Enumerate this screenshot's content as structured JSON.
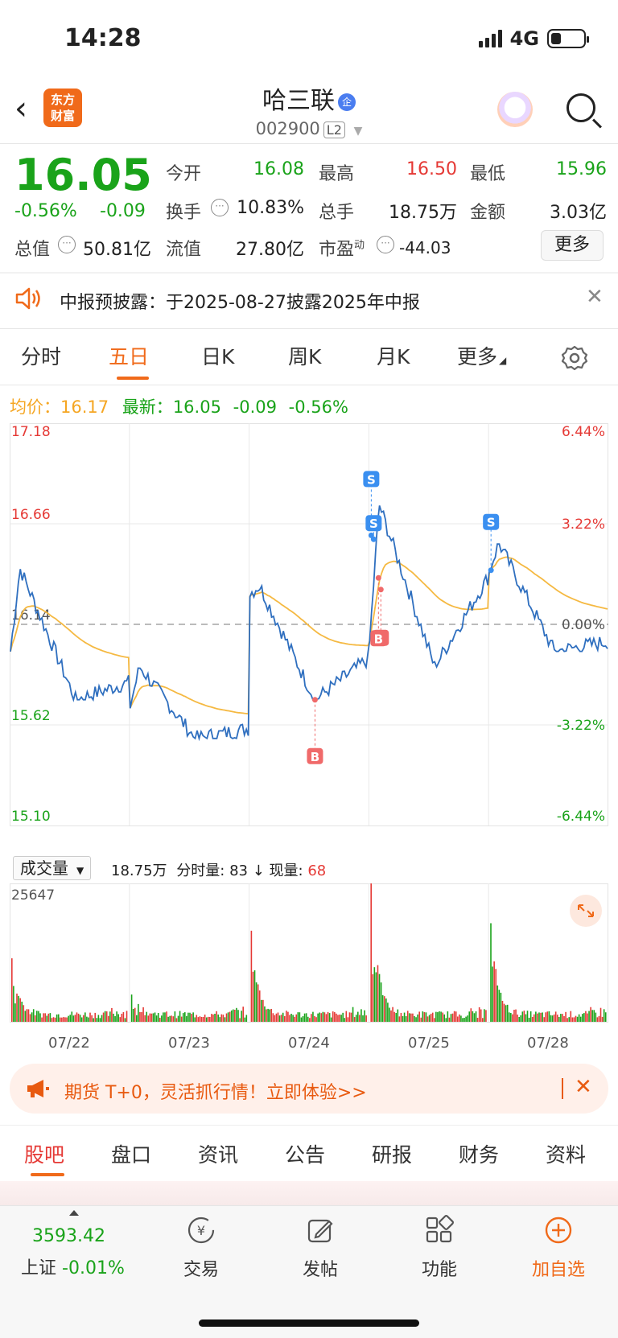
{
  "status_bar": {
    "time": "14:28",
    "network": "4G"
  },
  "header": {
    "logo_text": "东方财富",
    "stock_name": "哈三联",
    "name_badge": "企",
    "stock_code": "002900",
    "level_badge": "L2"
  },
  "quote": {
    "price": "16.05",
    "change_pct": "-0.56%",
    "change": "-0.09",
    "fields": [
      {
        "label": "今开",
        "value": "16.08",
        "color": "green"
      },
      {
        "label": "最高",
        "value": "16.50",
        "color": "red"
      },
      {
        "label": "最低",
        "value": "15.96",
        "color": "green"
      },
      {
        "label": "换手",
        "value": "10.83%",
        "color": "black"
      },
      {
        "label": "总手",
        "value": "18.75万",
        "color": "black"
      },
      {
        "label": "金额",
        "value": "3.03亿",
        "color": "black"
      },
      {
        "label": "总值",
        "value": "50.81亿",
        "color": "black"
      },
      {
        "label": "流值",
        "value": "27.80亿",
        "color": "black"
      },
      {
        "label": "市盈",
        "value": "-44.03",
        "color": "black"
      }
    ],
    "pe_superscript": "动",
    "more_label": "更多"
  },
  "notice": {
    "text": "中报预披露：于2025-08-27披露2025年中报"
  },
  "chart_tabs": [
    "分时",
    "五日",
    "日K",
    "周K",
    "月K",
    "更多"
  ],
  "active_chart_tab": "五日",
  "legend": {
    "avg_label": "均价：",
    "avg_value": "16.17",
    "latest_label": "最新：",
    "latest_value": "16.05",
    "latest_change": "-0.09",
    "latest_pct": "-0.56%"
  },
  "chart_data": {
    "type": "line",
    "title": "",
    "x": [
      "07/22",
      "07/23",
      "07/24",
      "07/25",
      "07/28"
    ],
    "price_axis_labels": [
      "17.18",
      "16.66",
      "16.14",
      "15.62",
      "15.10"
    ],
    "pct_axis_labels": [
      "6.44%",
      "3.22%",
      "0.00%",
      "-3.22%",
      "-6.44%"
    ],
    "ylim": [
      15.1,
      17.18
    ],
    "prev_close": 16.14,
    "series": [],
    "daily_summary": [
      {
        "date": "07/22",
        "open": 16.0,
        "high": 16.43,
        "low": 15.75,
        "close": 15.84
      },
      {
        "date": "07/23",
        "open": 15.72,
        "high": 15.92,
        "low": 15.55,
        "close": 15.6
      },
      {
        "date": "07/24",
        "open": 16.3,
        "high": 16.34,
        "low": 15.75,
        "close": 15.96
      },
      {
        "date": "07/25",
        "open": 16.05,
        "high": 16.76,
        "low": 15.92,
        "close": 16.38
      },
      {
        "date": "07/28",
        "open": 16.42,
        "high": 16.56,
        "low": 16.0,
        "close": 16.05
      }
    ],
    "trade_markers": [
      {
        "type": "B",
        "date": "07/24"
      },
      {
        "type": "S",
        "date": "07/25"
      },
      {
        "type": "S",
        "date": "07/25"
      },
      {
        "type": "B",
        "date": "07/25"
      },
      {
        "type": "B",
        "date": "07/25"
      },
      {
        "type": "S",
        "date": "07/28"
      }
    ],
    "volume": {
      "label": "成交量",
      "max_label": "25647",
      "total": "18.75万",
      "minute_vol_label": "分时量:",
      "minute_vol": "83",
      "arrow": "↓",
      "current_label": "现量:",
      "current": "68",
      "peaks_by_day": [
        {
          "date": "07/22",
          "peak": 11000
        },
        {
          "date": "07/23",
          "peak": 4200
        },
        {
          "date": "07/24",
          "peak": 15500
        },
        {
          "date": "07/25",
          "peak": 25647
        },
        {
          "date": "07/28",
          "peak": 17000
        }
      ]
    },
    "colors": {
      "price_line": "#2f6fbf",
      "avg_line": "#f5b942",
      "up": "#e53935",
      "down": "#1aa31a"
    }
  },
  "promo": {
    "text": "期货 T+0，灵活抓行情！立即体验>>"
  },
  "bottom_tabs": [
    "股吧",
    "盘口",
    "资讯",
    "公告",
    "研报",
    "财务",
    "资料"
  ],
  "active_bottom_tab": "股吧",
  "bottom_nav": {
    "index_value": "3593.42",
    "index_name": "上证",
    "index_change": "-0.01%",
    "items": [
      "交易",
      "发帖",
      "功能",
      "加自选"
    ]
  }
}
